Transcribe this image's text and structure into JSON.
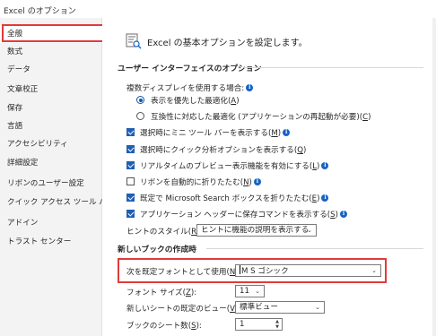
{
  "window": {
    "title": "Excel のオプション"
  },
  "sidebar": {
    "items": [
      {
        "label": "全般",
        "selected": true
      },
      {
        "label": "数式"
      },
      {
        "label": "データ"
      },
      {
        "label": "文章校正"
      },
      {
        "label": "保存"
      },
      {
        "label": "言語"
      },
      {
        "label": "アクセシビリティ"
      },
      {
        "label": "詳細設定"
      },
      {
        "label": "リボンのユーザー設定"
      },
      {
        "label": "クイック アクセス ツール バー"
      },
      {
        "label": "アドイン"
      },
      {
        "label": "トラスト センター"
      }
    ]
  },
  "header": {
    "text": "Excel の基本オプションを設定します。"
  },
  "ui_section": {
    "title": "ユーザー インターフェイスのオプション",
    "multi_display_label": "複数ディスプレイを使用する場合:",
    "radio_optimize_appearance": {
      "label": "表示を優先した最適化(",
      "key": "A",
      "suffix": ")",
      "selected": true
    },
    "radio_optimize_compat": {
      "label": "互換性に対応した最適化 (アプリケーションの再起動が必要)(",
      "key": "C",
      "suffix": ")",
      "selected": false
    },
    "checkboxes": [
      {
        "label": "選択時にミニ ツール バーを表示する(",
        "key": "M",
        "suffix": ")",
        "checked": true,
        "info": true
      },
      {
        "label": "選択時にクイック分析オプションを表示する(",
        "key": "Q",
        "suffix": ")",
        "checked": true,
        "info": false
      },
      {
        "label": "リアルタイムのプレビュー表示機能を有効にする(",
        "key": "L",
        "suffix": ")",
        "checked": true,
        "info": true
      },
      {
        "label": "リボンを自動的に折りたたむ(",
        "key": "N",
        "suffix": ")",
        "checked": false,
        "info": true
      },
      {
        "label": "既定で Microsoft Search ボックスを折りたたむ(",
        "key": "E",
        "suffix": ")",
        "checked": true,
        "info": true
      },
      {
        "label": "アプリケーション ヘッダーに保存コマンドを表示する(",
        "key": "S",
        "suffix": ")",
        "checked": true,
        "info": true
      }
    ],
    "tooltip_style_label": "ヒントのスタイル(",
    "tooltip_style_key": "R",
    "tooltip_style_suffix": "):",
    "tooltip_style_value": "ヒントに機能の説明を表示する"
  },
  "new_workbook": {
    "title": "新しいブックの作成時",
    "default_font_label": "次を既定フォントとして使用(",
    "default_font_key": "N",
    "default_font_suffix": "):",
    "default_font_value": "M S ゴシック",
    "font_size_label": "フォント サイズ(",
    "font_size_key": "Z",
    "font_size_suffix": "):",
    "font_size_value": "11",
    "default_view_label": "新しいシートの既定のビュー(",
    "default_view_key": "V",
    "default_view_suffix": "):",
    "default_view_value": "標準ビュー",
    "sheet_count_label": "ブックのシート数(",
    "sheet_count_key": "S",
    "sheet_count_suffix": "):",
    "sheet_count_value": "1"
  },
  "colors": {
    "accent": "#1f5fb6",
    "highlight": "#e23a3a",
    "sidebar_bg": "#f3f3f3"
  },
  "icons": {
    "info": "info-icon",
    "header": "options-page-icon",
    "dropdown": "chevron-down-icon",
    "spinner": "spinner-arrows-icon"
  }
}
